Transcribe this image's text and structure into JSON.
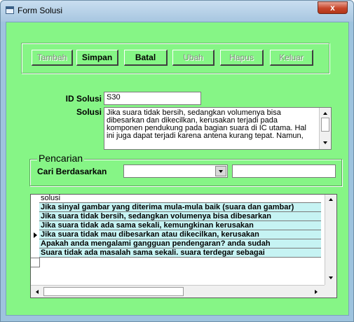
{
  "window": {
    "title": "Form Solusi",
    "close_label": "x",
    "accent": "#86f586"
  },
  "toolbar": {
    "buttons": [
      {
        "label": "Tambah",
        "enabled": false
      },
      {
        "label": "Simpan",
        "enabled": true
      },
      {
        "label": "Batal",
        "enabled": true
      },
      {
        "label": "Ubah",
        "enabled": false
      },
      {
        "label": "Hapus",
        "enabled": false
      },
      {
        "label": "Keluar",
        "enabled": false
      }
    ]
  },
  "form": {
    "id_label": "ID Solusi",
    "id_value": "S30",
    "solusi_label": "Solusi",
    "solusi_lines": [
      "Jika suara tidak bersih, sedangkan volumenya bisa",
      "dibesarkan dan dikecilkan, kerusakan terjadi pada",
      "komponen pendukung pada bagian suara di IC utama. Hal",
      "ini juga dapat terjadi karena antena kurang tepat. Namun,"
    ]
  },
  "search": {
    "legend": "Pencarian",
    "label": "Cari Berdasarkan",
    "combo_value": "",
    "text_value": ""
  },
  "grid": {
    "column": "solusi",
    "rows": [
      "Jika sinyal gambar yang diterima mula-mula baik (suara dan gambar)",
      "Jika suara tidak bersih, sedangkan volumenya bisa dibesarkan",
      "Jika suara tidak ada sama sekali, kemungkinan kerusakan",
      "Jika suara tidak mau dibesarkan atau dikecilkan, kerusakan",
      "Apakah anda mengalami gangguan pendengaran? anda sudah",
      "Suara tidak ada masalah sama sekali. suara terdegar sebagai"
    ],
    "current_row": 3
  }
}
